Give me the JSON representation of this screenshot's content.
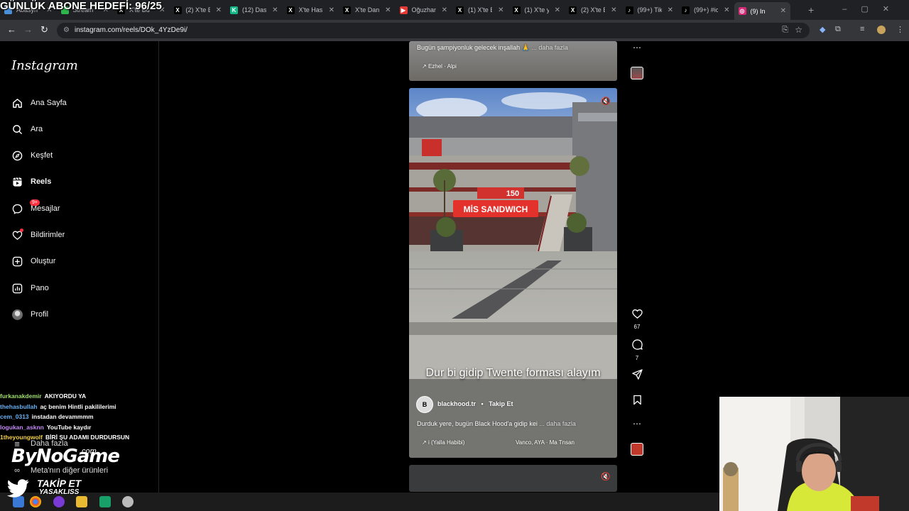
{
  "overlay": {
    "title": "GÜNLÜK ABONE HEDEFİ: 96/25"
  },
  "browser": {
    "tabs": [
      {
        "title": "Abasyn",
        "icon_color": "#4a90d9",
        "glyph": ""
      },
      {
        "title": "Stream",
        "icon_color": "#2db84d",
        "glyph": ""
      },
      {
        "title": "X'te Bu",
        "icon_color": "#000000",
        "glyph": "X"
      },
      {
        "title": "(2) X'te B",
        "icon_color": "#000000",
        "glyph": "X"
      },
      {
        "title": "(12) Das",
        "icon_color": "#12b886",
        "glyph": "K"
      },
      {
        "title": "X'te Has",
        "icon_color": "#000000",
        "glyph": "X"
      },
      {
        "title": "X'te Dan",
        "icon_color": "#000000",
        "glyph": "X"
      },
      {
        "title": "Oğuzhan",
        "icon_color": "#e53935",
        "glyph": "▶"
      },
      {
        "title": "(1) X'te B",
        "icon_color": "#000000",
        "glyph": "X"
      },
      {
        "title": "(1) X'te y",
        "icon_color": "#000000",
        "glyph": "X"
      },
      {
        "title": "(2) X'te B",
        "icon_color": "#000000",
        "glyph": "X"
      },
      {
        "title": "(99+) Tik",
        "icon_color": "#000000",
        "glyph": "♪"
      },
      {
        "title": "(99+) #ic",
        "icon_color": "#000000",
        "glyph": "♪"
      },
      {
        "title": "(9) In",
        "icon_color": "#d62976",
        "glyph": "◎"
      }
    ],
    "url": "instagram.com/reels/DOk_4YzDe9i/"
  },
  "sidebar": {
    "logo": "Instagram",
    "items": [
      {
        "label": "Ana Sayfa",
        "icon": "home-icon"
      },
      {
        "label": "Ara",
        "icon": "search-icon"
      },
      {
        "label": "Keşfet",
        "icon": "compass-icon"
      },
      {
        "label": "Reels",
        "icon": "reels-icon"
      },
      {
        "label": "Mesajlar",
        "icon": "messenger-icon",
        "badge": "9+"
      },
      {
        "label": "Bildirimler",
        "icon": "heart-icon"
      },
      {
        "label": "Oluştur",
        "icon": "plus-square-icon"
      },
      {
        "label": "Pano",
        "icon": "dashboard-icon"
      },
      {
        "label": "Profil",
        "icon": "profile-avatar-icon"
      }
    ],
    "more": "Daha fazla",
    "meta": "Meta'nın diğer ürünleri"
  },
  "reel_prev": {
    "caption": "Bugün şampiyonluk gelecek inşallah 🙏",
    "more": "... daha fazla",
    "audio": "Ezhel · Alpi"
  },
  "reel": {
    "subtitle": "Dur bi gidip Twente forması alayım",
    "username": "blackhood.tr",
    "separator": "•",
    "follow": "Takip Et",
    "caption": "Durduk yere, bugün Black Hood'a gidip kei",
    "more": "... daha fazla",
    "audio": "i (Yalla Habibi)",
    "audio_artists": "Vanco, AYA · Ma Tnsan",
    "sign_text": "MİS SANDWICH",
    "sign_price": "150",
    "likes": "67",
    "comments": "7"
  },
  "chat": [
    {
      "user": "furkanakdemir",
      "msg": "AKIYORDU YA",
      "color": "#9ee06a"
    },
    {
      "user": "thehasbullah",
      "msg": "aç benim Hintli pakililerimi",
      "color": "#6ab0f3"
    },
    {
      "user": "cem_0313",
      "msg": "instadan devammmm",
      "color": "#6ab0f3"
    },
    {
      "user": "logukan_asknn",
      "msg": "YouTube kaydır",
      "color": "#c38cf5"
    },
    {
      "user": "1theyoungwolf",
      "msg": "BİRİ ŞU ADAMI DURDURSUN",
      "color": "#f5d142"
    }
  ],
  "branding": {
    "name": "ByNoGame",
    "domain": ".com",
    "follow_a": "TAKİP ET",
    "follow_b": "YASAKLISS"
  }
}
